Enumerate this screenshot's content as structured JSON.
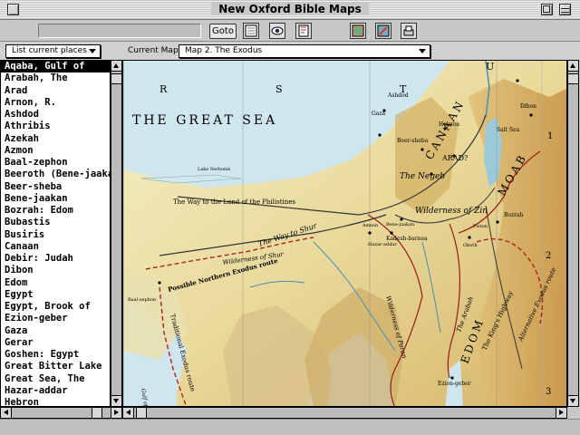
{
  "window": {
    "title": "New Oxford Bible Maps"
  },
  "toolbar": {
    "goto_label": "Goto",
    "icons": [
      "notes-icon",
      "eye-icon",
      "bookmark-icon",
      "map-book-icon",
      "compass-icon",
      "print-icon"
    ]
  },
  "controls": {
    "list_popup_label": "List current places",
    "current_map_label": "Current Map:",
    "current_map_value": "Map 2. The Exodus"
  },
  "places": [
    "Aqaba, Gulf of",
    "Arabah, The",
    "Arad",
    "Arnon, R.",
    "Ashdod",
    "Athribis",
    "Azekah",
    "Azmon",
    "Baal-zephon",
    "Beeroth (Bene-jaakan)",
    "Beer-sheba",
    "Bene-jaakan",
    "Bozrah: Edom",
    "Bubastis",
    "Busiris",
    "Canaan",
    "Debir: Judah",
    "Dibon",
    "Edom",
    "Egypt",
    "Egypt, Brook of",
    "Ezion-geber",
    "Gaza",
    "Gerar",
    "Goshen: Egypt",
    "Great Bitter Lake",
    "Great Sea, The",
    "Hazar-addar",
    "Hebron"
  ],
  "selected_place": "Aqaba, Gulf of",
  "map": {
    "grid_letters": [
      "R",
      "S",
      "T",
      "U"
    ],
    "grid_numbers": [
      "1",
      "2",
      "3"
    ],
    "labels": {
      "great_sea": "THE GREAT SEA",
      "canaan": "CANAAN",
      "moab": "MOAB",
      "edom": "EDOM",
      "negeb": "The Negeb",
      "wilderness_zin": "Wilderness of Zin",
      "wilderness_shur": "Wilderness of Shur",
      "wilderness_paran": "Wilderness of Paran",
      "way_philistines": "The Way to the Land of the Philistines",
      "way_shur": "The Way to Shur",
      "northern_route": "Possible Northern Exodus route",
      "traditional_route": "Traditional Exodus route",
      "kings_highway": "The King's Highway",
      "alternative_route": "Alternative Exodus route",
      "arabah": "The Arabah",
      "arad": "ARAD?",
      "gaza": "Gaza",
      "beer_sheba": "Beer-sheba",
      "hebron": "Hebron",
      "salt_sea": "Salt Sea",
      "ashdod": "Ashdod",
      "kadesh": "Kadesh-barnea",
      "ezion": "Ezion-geber",
      "bozrah": "Bozrah",
      "dibon": "Dibon",
      "lake_serbonis": "Lake Serbonis",
      "baal_zephon": "Baal-zephon",
      "gulf_suez": "Gulf of Suez",
      "azmon": "Azmon",
      "hazar_addar": "Hazar-addar",
      "bene_jaakan": "Bene-jaakan",
      "punon": "Punon",
      "oboth": "Oboth"
    }
  }
}
